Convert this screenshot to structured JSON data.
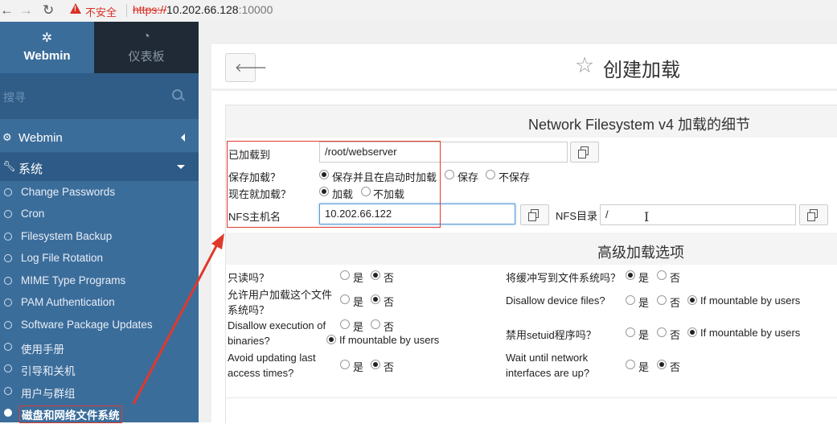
{
  "browser": {
    "insecure_label": "不安全",
    "url_scheme": "https://",
    "url_host": "10.202.66.128",
    "url_port": ":10000"
  },
  "sidebar": {
    "brand_label": "Webmin",
    "dashboard_label": "仪表板",
    "search_placeholder": "搜寻",
    "categories": {
      "webmin": "Webmin",
      "system": "系统"
    },
    "items": [
      "Change Passwords",
      "Cron",
      "Filesystem Backup",
      "Log File Rotation",
      "MIME Type Programs",
      "PAM Authentication",
      "Software Package Updates",
      "使用手册",
      "引导和关机",
      "用户与群组",
      "磁盘和网络文件系统"
    ]
  },
  "header": {
    "title": "创建加载"
  },
  "section": {
    "title": "Network Filesystem v4 加载的细节"
  },
  "form": {
    "mounted_on_label": "已加载到",
    "mounted_on_value": "/root/webserver",
    "save_mount_label": "保存加载？",
    "save_mount_options": [
      "保存并且在启动时加载",
      "保存",
      "不保存"
    ],
    "mount_now_label": "现在就加载？",
    "mount_now_options": [
      "加载",
      "不加载"
    ],
    "nfs_host_label": "NFS主机名",
    "nfs_host_value": "10.202.66.122",
    "nfs_dir_label": "NFS目录",
    "nfs_dir_value": "/"
  },
  "advanced": {
    "title": "高级加载选项",
    "yes": "是",
    "no": "否",
    "if_mountable": "If mountable by users",
    "read_only_label": "只读吗？",
    "write_buffer_label": "将缓冲写到文件系统吗？",
    "allow_user_mount_label_1": "允许用户加载这个文件",
    "allow_user_mount_label_2": "系统吗？",
    "disallow_device_label": "Disallow device files?",
    "disallow_exec_label_1": "Disallow execution of",
    "disallow_exec_label_2": "binaries?",
    "disable_setuid_label": "禁用setuid程序吗？",
    "avoid_atime_label_1": "Avoid updating last",
    "avoid_atime_label_2": "access times?",
    "wait_network_label_1": "Wait until network",
    "wait_network_label_2": "interfaces are up?"
  },
  "colors": {
    "sidebar": "#3b6d9b",
    "annotation": "#e0392b",
    "insecure": "#d93025"
  }
}
